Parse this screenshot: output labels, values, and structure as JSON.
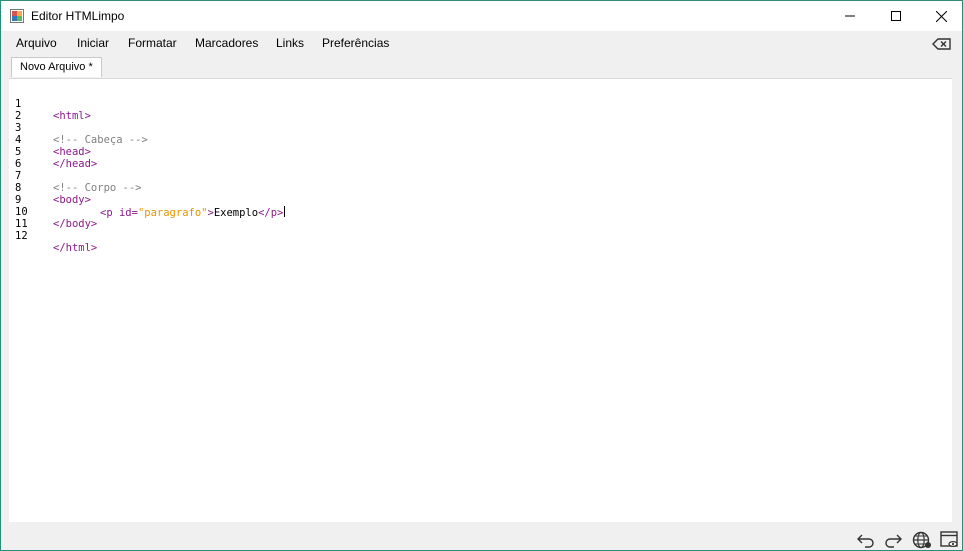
{
  "window": {
    "title": "Editor HTMLimpo",
    "buttons": {
      "minimize": "minimize-icon",
      "maximize": "maximize-icon",
      "close": "close-icon"
    }
  },
  "menu": {
    "items": [
      "Arquivo",
      "Iniciar",
      "Formatar",
      "Marcadores",
      "Links",
      "Preferências"
    ],
    "right_icon": "backspace-clear-icon"
  },
  "tabs": [
    {
      "label": "Novo Arquivo *",
      "active": true
    }
  ],
  "editor": {
    "line_numbers": [
      "1",
      "2",
      "3",
      "4",
      "5",
      "6",
      "7",
      "8",
      "9",
      "10",
      "11",
      "12"
    ],
    "lines": [
      {
        "text": "<html>"
      },
      {
        "text": ""
      },
      {
        "text": "<!-- Cabeça -->"
      },
      {
        "text": "<head>"
      },
      {
        "text": "</head>"
      },
      {
        "text": ""
      },
      {
        "text": "<!-- Corpo -->"
      },
      {
        "text": "<body>"
      },
      {
        "text": "<p id=\"paragrafo\">Exemplo</p>"
      },
      {
        "text": "</body>"
      },
      {
        "text": ""
      },
      {
        "text": "</html>"
      }
    ],
    "colors": {
      "tag": "#8a1a8a",
      "comment": "#808080",
      "string": "#e69500",
      "text": "#000000"
    }
  },
  "toolbar": {
    "icons": [
      "undo-icon",
      "redo-icon",
      "browser-preview-icon",
      "window-preview-icon"
    ]
  },
  "accent": "#2e8b7a"
}
